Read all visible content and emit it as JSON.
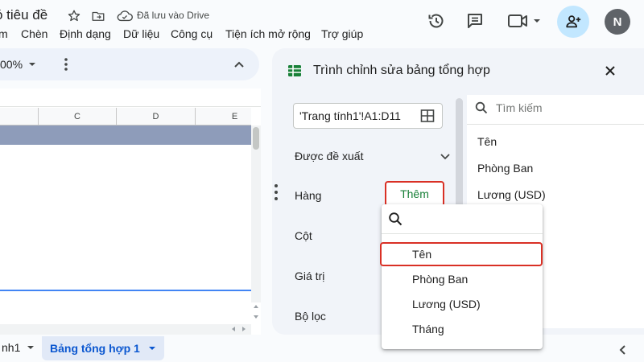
{
  "header": {
    "doc_title": "ó tiêu đề",
    "saved_status": "Đã lưu vào Drive",
    "avatar_initial": "N"
  },
  "menu": [
    "Chèn",
    "Định dạng",
    "Dữ liệu",
    "Công cụ",
    "Tiện ích mở rộng",
    "Trợ giúp"
  ],
  "menu_partial": "m",
  "toolbar": {
    "zoom": "00%"
  },
  "sheet": {
    "columns": [
      "C",
      "D",
      "E"
    ]
  },
  "tabs": {
    "sheet1": "nh1",
    "pivot": "Bảng tổng hợp 1"
  },
  "pivot_editor": {
    "title": "Trình chỉnh sửa bảng tổng hợp",
    "range": "'Trang tính1'!A1:D11",
    "suggested_label": "Được đề xuất",
    "rows_label": "Hàng",
    "columns_label": "Cột",
    "values_label": "Giá trị",
    "filter_label": "Bộ lọc",
    "add_label": "Thêm",
    "search_placeholder": "Tìm kiếm",
    "fields": [
      "Tên",
      "Phòng Ban",
      "Lương (USD)"
    ]
  },
  "dropdown": {
    "options": [
      "Tên",
      "Phòng Ban",
      "Lương (USD)",
      "Tháng"
    ]
  },
  "colors": {
    "accent": "#0b57d0",
    "highlight_border": "#d93025",
    "add_text": "#188038",
    "share_bg": "#c2e7ff"
  }
}
